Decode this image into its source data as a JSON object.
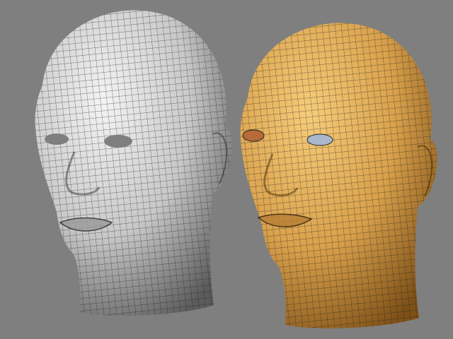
{
  "colors": {
    "background": "#7f7f7f",
    "gray_head_light": "#f2f2f2",
    "gray_head_dark": "#5a5a5a",
    "orange_head_light": "#f4c46e",
    "orange_head_dark": "#8a5a1c",
    "mesh_line": "#1a1a1a",
    "eye_fill": "#a9b8cc"
  }
}
